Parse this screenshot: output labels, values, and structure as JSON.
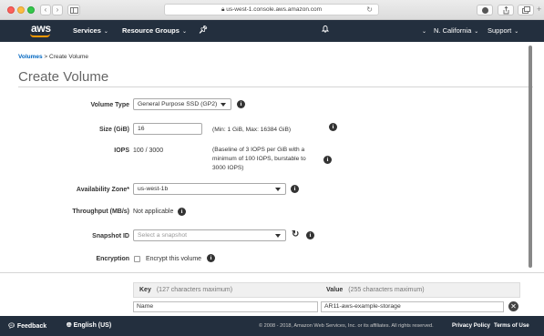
{
  "browser": {
    "url": "us-west-1.console.aws.amazon.com"
  },
  "nav": {
    "logo": "aws",
    "services": "Services",
    "resource_groups": "Resource Groups",
    "region": "N. California",
    "support": "Support"
  },
  "breadcrumb": {
    "parent": "Volumes",
    "separator": " > ",
    "current": "Create Volume"
  },
  "page_title": "Create Volume",
  "form": {
    "volume_type": {
      "label": "Volume Type",
      "value": "General Purpose SSD (GP2)"
    },
    "size": {
      "label": "Size (GiB)",
      "value": "16",
      "hint": "(Min: 1 GiB, Max: 16384 GiB)"
    },
    "iops": {
      "label": "IOPS",
      "value": "100 / 3000",
      "note_lines": [
        "(Baseline of 3 IOPS per GiB with a",
        "minimum of 100 IOPS, burstable to",
        "3000 IOPS)"
      ]
    },
    "availability_zone": {
      "label": "Availability Zone*",
      "value": "us-west-1b"
    },
    "throughput": {
      "label": "Throughput (MB/s)",
      "value": "Not applicable"
    },
    "snapshot": {
      "label": "Snapshot ID",
      "placeholder": "Select a snapshot"
    },
    "encryption": {
      "label": "Encryption",
      "option": "Encrypt this volume"
    }
  },
  "tags": {
    "key_header": "Key",
    "key_hint": "(127 characters maximum)",
    "value_header": "Value",
    "value_hint": "(255 characters maximum)",
    "rows": [
      {
        "key": "Name",
        "value": "AR11-aws-example-storage"
      }
    ]
  },
  "footer": {
    "feedback": "Feedback",
    "language": "English (US)",
    "copyright": "© 2008 - 2018, Amazon Web Services, Inc. or its affiliates. All rights reserved.",
    "privacy": "Privacy Policy",
    "terms": "Terms of Use"
  },
  "colors": {
    "nav_bg": "#232f3e",
    "aws_orange": "#ff9900",
    "link_blue": "#0066c0"
  }
}
